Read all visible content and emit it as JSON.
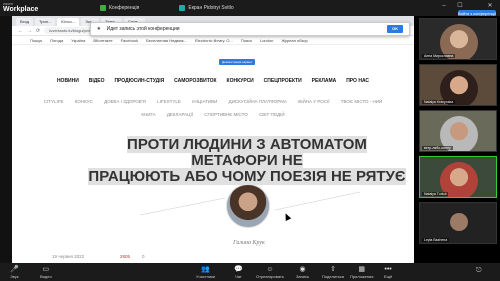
{
  "app": {
    "logo_top": "zoom",
    "logo_name": "Workplace"
  },
  "topbar": {
    "conference_label": "Конференція",
    "screen_share_label": "Екран Pidstryi Svitlo"
  },
  "exit_button": "Вийти з конференції",
  "browser": {
    "tabs": [
      "Вход",
      "Трин...",
      "Юлсо...",
      "Экс...",
      "Тема...",
      "Слов..."
    ],
    "url": "luverkssto.fu/blogu/proty_lyudyny_z_avtomatom_metafory_ne_pratsyuyut_abo_chomu_poeziya_ne_ryatuye_133805.html",
    "bookmarks": [
      "Пошук",
      "Погода",
      "Україна",
      "ВКонтакте",
      "Facebook",
      "Бесплатная Недвиж...",
      "Electronic library. O...",
      "Поиск",
      "London",
      "Журнал обзор"
    ]
  },
  "popup": {
    "text": "Идет запись этой конференции",
    "ok": "OK"
  },
  "share_badge": "Демонстрація екрана",
  "main_nav": [
    "НОВИНИ",
    "ВІДЕО",
    "ПРОДЮСИН-СТУДІЯ",
    "САМОРОЗВИТОК",
    "КОНКУРСИ",
    "СПЕЦПРОЕКТИ",
    "РЕКЛАМА",
    "ПРО НАС"
  ],
  "sub_nav": [
    "CITYLIFE",
    "КОНКУС",
    "ДОВКА І ЗДОРОВ'Я",
    "LIFESTYLE",
    "ІНІЦІАТИВИ",
    "ДИСКУСІЙНА ПЛАТФОРМА",
    "ВІЙНА У РОСІЇ",
    "ТВОЄ МІСТО - НИЙ",
    "КНИГА",
    "ДЕКЛАРАЦІЇ",
    "СПОРТИВНЕ МІСТО",
    "СВІТ ПОДІЙ"
  ],
  "article": {
    "title_line1": "ПРОТИ ЛЮДИНИ З АВТОМАТОМ МЕТАФОРИ НЕ",
    "title_line2": "ПРАЦЮЮТЬ АБО ЧОМУ ПОЕЗІЯ НЕ РЯТУЄ",
    "author": "Галина Крук",
    "date": "19 червня 2022",
    "views": "2805",
    "comments": "0"
  },
  "participants": [
    "Анна Мирославна",
    "Natalya Kravynska",
    "вєтр-лябо-моглу",
    "Natalya Turkul",
    "Leyla Bazhenа"
  ],
  "bottombar": {
    "buttons": [
      "Звук",
      "Видео",
      "Участники",
      "Чат",
      "Отреагировать",
      "Запись",
      "Поделиться",
      "Приложения",
      "Ещё"
    ]
  }
}
